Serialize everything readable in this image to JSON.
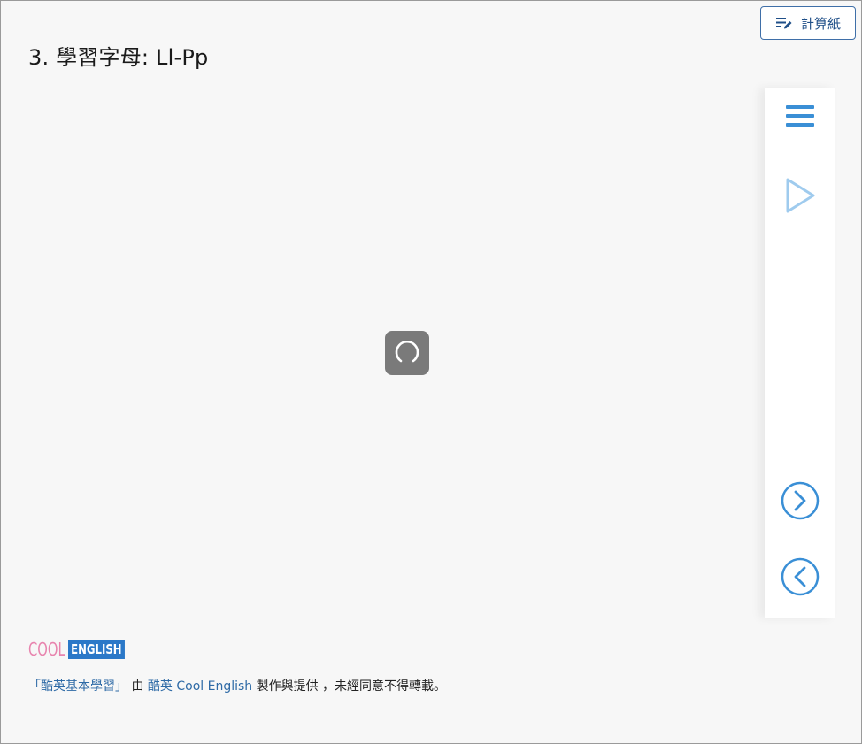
{
  "header": {
    "scratch_label": "計算紙",
    "title": "3. 學習字母: Ll-Pp"
  },
  "player": {
    "loading": true,
    "side_buttons": [
      {
        "name": "menu-icon"
      },
      {
        "name": "play-icon"
      },
      {
        "name": "next-icon"
      },
      {
        "name": "prev-icon"
      }
    ]
  },
  "logo": {
    "part1": "COOL",
    "part2": "ENGLISH"
  },
  "footer": {
    "course_link": "「酷英基本學習」",
    "by": " 由 ",
    "provider_link": "酷英 Cool English",
    "rest": " 製作與提供 ，未經同意不得轉載。"
  },
  "colors": {
    "accent": "#3a8fd6",
    "accent_light": "#9fcbee",
    "logo_pink": "#e884ae",
    "logo_blue": "#2b78c8",
    "link": "#2e6aa6"
  }
}
